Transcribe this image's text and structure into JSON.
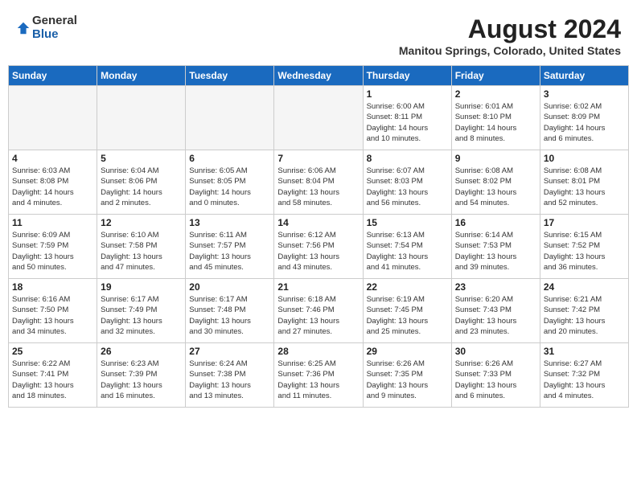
{
  "header": {
    "logo_general": "General",
    "logo_blue": "Blue",
    "month_title": "August 2024",
    "location": "Manitou Springs, Colorado, United States"
  },
  "days_of_week": [
    "Sunday",
    "Monday",
    "Tuesday",
    "Wednesday",
    "Thursday",
    "Friday",
    "Saturday"
  ],
  "weeks": [
    [
      {
        "num": "",
        "info": "",
        "empty": true
      },
      {
        "num": "",
        "info": "",
        "empty": true
      },
      {
        "num": "",
        "info": "",
        "empty": true
      },
      {
        "num": "",
        "info": "",
        "empty": true
      },
      {
        "num": "1",
        "info": "Sunrise: 6:00 AM\nSunset: 8:11 PM\nDaylight: 14 hours\nand 10 minutes."
      },
      {
        "num": "2",
        "info": "Sunrise: 6:01 AM\nSunset: 8:10 PM\nDaylight: 14 hours\nand 8 minutes."
      },
      {
        "num": "3",
        "info": "Sunrise: 6:02 AM\nSunset: 8:09 PM\nDaylight: 14 hours\nand 6 minutes."
      }
    ],
    [
      {
        "num": "4",
        "info": "Sunrise: 6:03 AM\nSunset: 8:08 PM\nDaylight: 14 hours\nand 4 minutes."
      },
      {
        "num": "5",
        "info": "Sunrise: 6:04 AM\nSunset: 8:06 PM\nDaylight: 14 hours\nand 2 minutes."
      },
      {
        "num": "6",
        "info": "Sunrise: 6:05 AM\nSunset: 8:05 PM\nDaylight: 14 hours\nand 0 minutes."
      },
      {
        "num": "7",
        "info": "Sunrise: 6:06 AM\nSunset: 8:04 PM\nDaylight: 13 hours\nand 58 minutes."
      },
      {
        "num": "8",
        "info": "Sunrise: 6:07 AM\nSunset: 8:03 PM\nDaylight: 13 hours\nand 56 minutes."
      },
      {
        "num": "9",
        "info": "Sunrise: 6:08 AM\nSunset: 8:02 PM\nDaylight: 13 hours\nand 54 minutes."
      },
      {
        "num": "10",
        "info": "Sunrise: 6:08 AM\nSunset: 8:01 PM\nDaylight: 13 hours\nand 52 minutes."
      }
    ],
    [
      {
        "num": "11",
        "info": "Sunrise: 6:09 AM\nSunset: 7:59 PM\nDaylight: 13 hours\nand 50 minutes."
      },
      {
        "num": "12",
        "info": "Sunrise: 6:10 AM\nSunset: 7:58 PM\nDaylight: 13 hours\nand 47 minutes."
      },
      {
        "num": "13",
        "info": "Sunrise: 6:11 AM\nSunset: 7:57 PM\nDaylight: 13 hours\nand 45 minutes."
      },
      {
        "num": "14",
        "info": "Sunrise: 6:12 AM\nSunset: 7:56 PM\nDaylight: 13 hours\nand 43 minutes."
      },
      {
        "num": "15",
        "info": "Sunrise: 6:13 AM\nSunset: 7:54 PM\nDaylight: 13 hours\nand 41 minutes."
      },
      {
        "num": "16",
        "info": "Sunrise: 6:14 AM\nSunset: 7:53 PM\nDaylight: 13 hours\nand 39 minutes."
      },
      {
        "num": "17",
        "info": "Sunrise: 6:15 AM\nSunset: 7:52 PM\nDaylight: 13 hours\nand 36 minutes."
      }
    ],
    [
      {
        "num": "18",
        "info": "Sunrise: 6:16 AM\nSunset: 7:50 PM\nDaylight: 13 hours\nand 34 minutes."
      },
      {
        "num": "19",
        "info": "Sunrise: 6:17 AM\nSunset: 7:49 PM\nDaylight: 13 hours\nand 32 minutes."
      },
      {
        "num": "20",
        "info": "Sunrise: 6:17 AM\nSunset: 7:48 PM\nDaylight: 13 hours\nand 30 minutes."
      },
      {
        "num": "21",
        "info": "Sunrise: 6:18 AM\nSunset: 7:46 PM\nDaylight: 13 hours\nand 27 minutes."
      },
      {
        "num": "22",
        "info": "Sunrise: 6:19 AM\nSunset: 7:45 PM\nDaylight: 13 hours\nand 25 minutes."
      },
      {
        "num": "23",
        "info": "Sunrise: 6:20 AM\nSunset: 7:43 PM\nDaylight: 13 hours\nand 23 minutes."
      },
      {
        "num": "24",
        "info": "Sunrise: 6:21 AM\nSunset: 7:42 PM\nDaylight: 13 hours\nand 20 minutes."
      }
    ],
    [
      {
        "num": "25",
        "info": "Sunrise: 6:22 AM\nSunset: 7:41 PM\nDaylight: 13 hours\nand 18 minutes."
      },
      {
        "num": "26",
        "info": "Sunrise: 6:23 AM\nSunset: 7:39 PM\nDaylight: 13 hours\nand 16 minutes."
      },
      {
        "num": "27",
        "info": "Sunrise: 6:24 AM\nSunset: 7:38 PM\nDaylight: 13 hours\nand 13 minutes."
      },
      {
        "num": "28",
        "info": "Sunrise: 6:25 AM\nSunset: 7:36 PM\nDaylight: 13 hours\nand 11 minutes."
      },
      {
        "num": "29",
        "info": "Sunrise: 6:26 AM\nSunset: 7:35 PM\nDaylight: 13 hours\nand 9 minutes."
      },
      {
        "num": "30",
        "info": "Sunrise: 6:26 AM\nSunset: 7:33 PM\nDaylight: 13 hours\nand 6 minutes."
      },
      {
        "num": "31",
        "info": "Sunrise: 6:27 AM\nSunset: 7:32 PM\nDaylight: 13 hours\nand 4 minutes."
      }
    ]
  ]
}
